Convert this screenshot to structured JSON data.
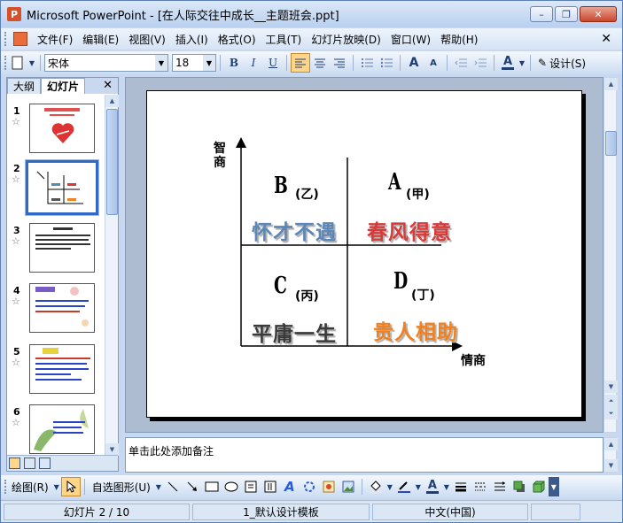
{
  "window": {
    "title": "Microsoft PowerPoint - [在人际交往中成长__主题班会.ppt]",
    "app_icon_letter": "P",
    "controls": {
      "minimize": "–",
      "restore": "❐",
      "close": "✕"
    }
  },
  "menubar": {
    "items": [
      "文件(F)",
      "编辑(E)",
      "视图(V)",
      "插入(I)",
      "格式(O)",
      "工具(T)",
      "幻灯片放映(D)",
      "窗口(W)",
      "帮助(H)"
    ],
    "close_glyph": "✕"
  },
  "toolbar": {
    "font_name": "宋体",
    "font_size": "18",
    "bold": "B",
    "italic": "I",
    "underline": "U",
    "font_color_glyph": "A",
    "grow_font": "A",
    "shrink_font": "A",
    "design_label": "设计(S)"
  },
  "left_pane": {
    "tabs": [
      "大纲",
      "幻灯片"
    ],
    "close_glyph": "✕",
    "thumbnails": [
      {
        "number": "1",
        "star": "☆"
      },
      {
        "number": "2",
        "star": "☆"
      },
      {
        "number": "3",
        "star": "☆"
      },
      {
        "number": "4",
        "star": "☆"
      },
      {
        "number": "5",
        "star": "☆"
      },
      {
        "number": "6",
        "star": "☆"
      }
    ],
    "selected_index": 2
  },
  "slide": {
    "y_axis_label": "智商",
    "x_axis_label": "情商",
    "quadrants": {
      "b": {
        "letter": "B",
        "sub": "(乙)",
        "phrase": "怀才不遇",
        "color": "#5b86b8"
      },
      "a": {
        "letter": "A",
        "sub": "(甲)",
        "phrase": "春风得意",
        "color": "#d83a3a"
      },
      "c": {
        "letter": "C",
        "sub": "(丙)",
        "phrase": "平庸一生",
        "color": "#3a3a3a"
      },
      "d": {
        "letter": "D",
        "sub": "(丁)",
        "phrase": "贵人相助",
        "color": "#f08020"
      }
    }
  },
  "notes": {
    "placeholder": "单击此处添加备注"
  },
  "drawbar": {
    "draw_label": "绘图(R)",
    "autoshape_label": "自选图形(U)"
  },
  "statusbar": {
    "slide_position": "幻灯片 2 / 10",
    "template": "1_默认设计模板",
    "language": "中文(中国)"
  }
}
